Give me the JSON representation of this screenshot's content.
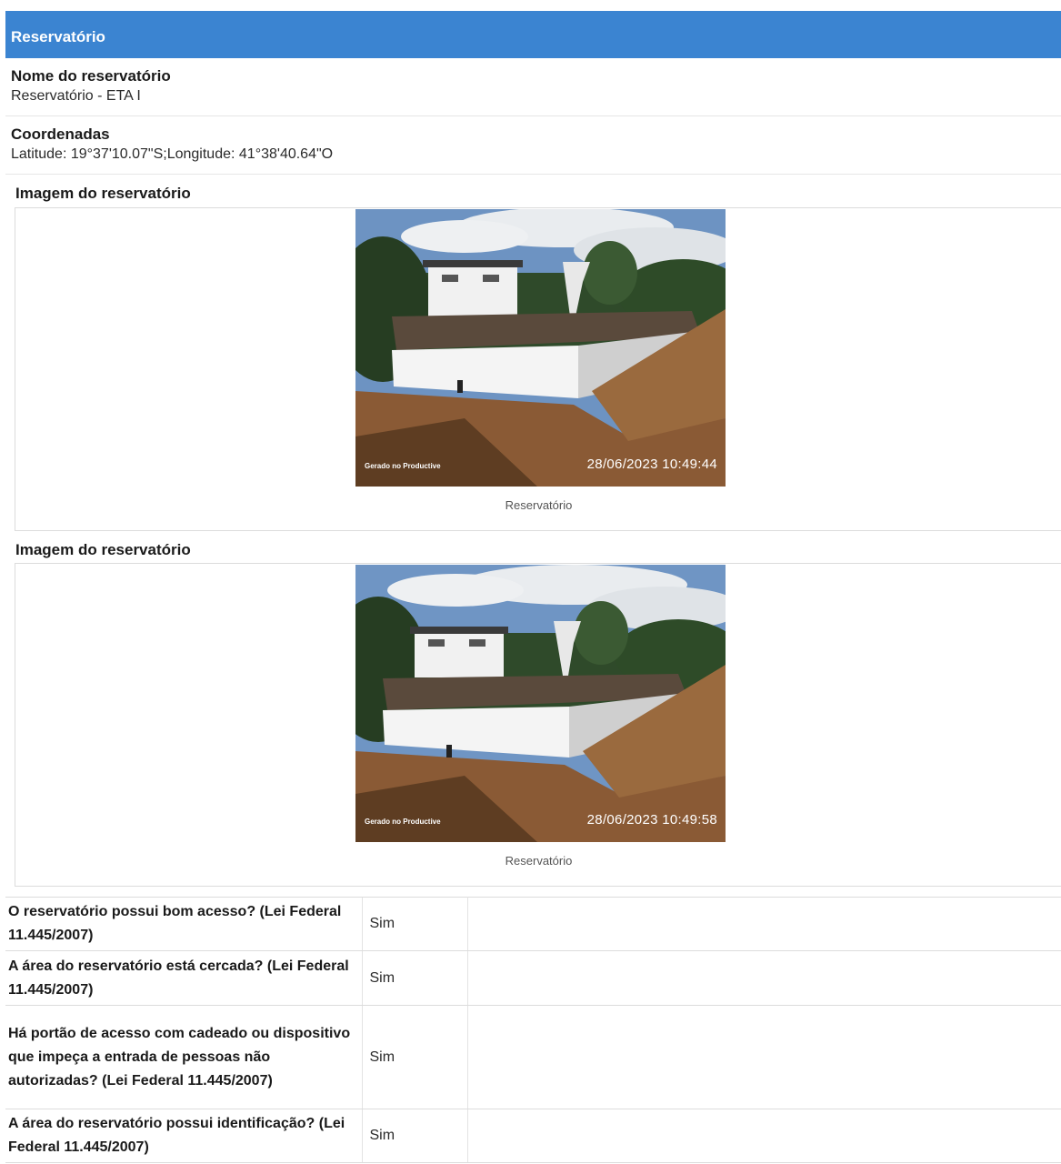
{
  "section": {
    "title": "Reservatório"
  },
  "reservoir_name": {
    "label": "Nome do reservatório",
    "value": "Reservatório - ETA I"
  },
  "coordinates": {
    "label": "Coordenadas",
    "value": "Latitude: 19°37'10.07\"S;Longitude: 41°38'40.64\"O"
  },
  "images": [
    {
      "label": "Imagem do reservatório",
      "watermark": "Gerado no Productive",
      "timestamp": "28/06/2023 10:49:44",
      "caption": "Reservatório"
    },
    {
      "label": "Imagem do reservatório",
      "watermark": "Gerado no Productive",
      "timestamp": "28/06/2023 10:49:58",
      "caption": "Reservatório"
    }
  ],
  "questions": [
    {
      "question": "O reservatório possui bom acesso? (Lei Federal 11.445/2007)",
      "answer": "Sim"
    },
    {
      "question": "A área do reservatório está cercada? (Lei Federal 11.445/2007)",
      "answer": "Sim"
    },
    {
      "question": "Há portão de acesso com cadeado ou dispositivo que impeça a entrada de pessoas não autorizadas? (Lei Federal 11.445/2007)",
      "answer": "Sim"
    },
    {
      "question": "A área do reservatório possui identificação? (Lei Federal 11.445/2007)",
      "answer": "Sim"
    }
  ],
  "colors": {
    "header_bg": "#3b84d1",
    "header_text": "#ffffff"
  }
}
